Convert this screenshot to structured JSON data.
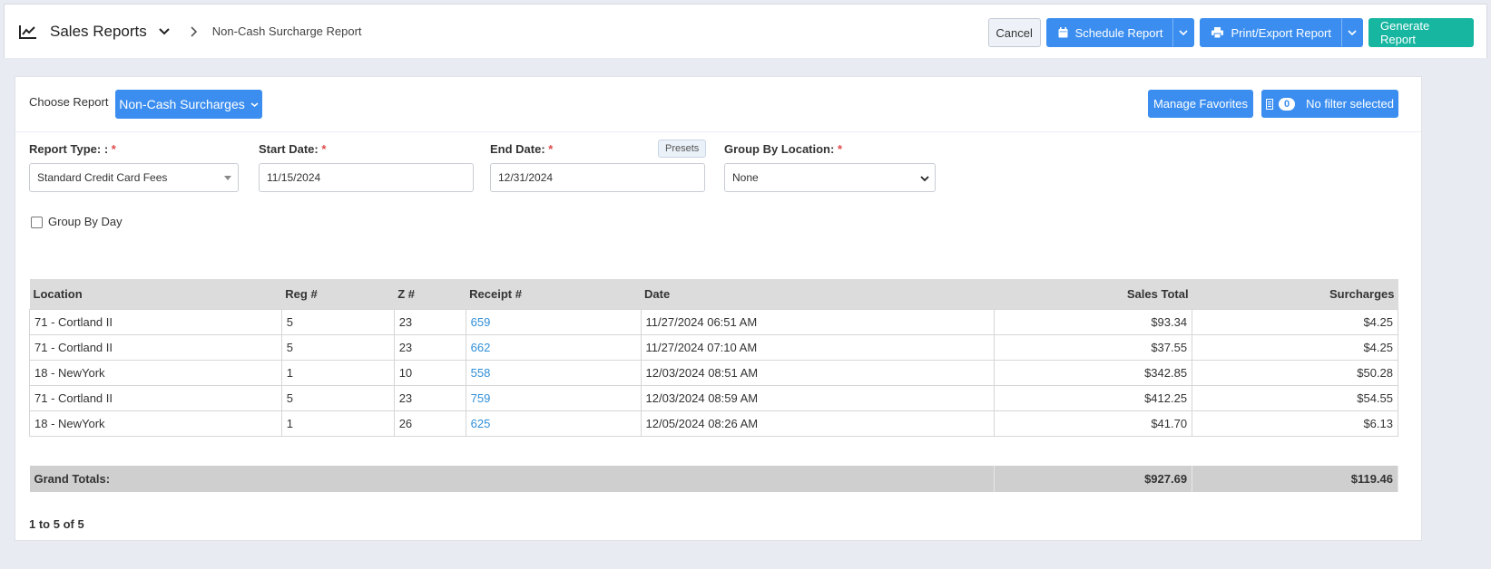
{
  "header": {
    "title": "Sales Reports",
    "breadcrumb": "Non-Cash Surcharge Report",
    "buttons": {
      "cancel": "Cancel",
      "schedule": "Schedule Report",
      "print_export": "Print/Export Report",
      "generate": "Generate Report"
    }
  },
  "toolbar": {
    "choose_label": "Choose Report",
    "choose_value": "Non-Cash Surcharges",
    "manage_favorites": "Manage Favorites",
    "filter_count": "0",
    "filter_label": "No filter selected"
  },
  "form": {
    "report_type": {
      "label": "Report Type: :",
      "value": "Standard Credit Card Fees"
    },
    "start_date": {
      "label": "Start Date:",
      "value": "11/15/2024"
    },
    "end_date": {
      "label": "End Date:",
      "value": "12/31/2024",
      "presets": "Presets"
    },
    "group_by_location": {
      "label": "Group By Location:",
      "value": "None"
    },
    "required_mark": "*",
    "group_by_day": {
      "label": "Group By Day",
      "checked": false
    }
  },
  "table": {
    "columns": [
      "Location",
      "Reg #",
      "Z #",
      "Receipt #",
      "Date",
      "Sales Total",
      "Surcharges"
    ],
    "rows": [
      [
        "71 - Cortland II",
        "5",
        "23",
        "659",
        "11/27/2024 06:51 AM",
        "$93.34",
        "$4.25"
      ],
      [
        "71 - Cortland II",
        "5",
        "23",
        "662",
        "11/27/2024 07:10 AM",
        "$37.55",
        "$4.25"
      ],
      [
        "18 - NewYork",
        "1",
        "10",
        "558",
        "12/03/2024 08:51 AM",
        "$342.85",
        "$50.28"
      ],
      [
        "71 - Cortland II",
        "5",
        "23",
        "759",
        "12/03/2024 08:59 AM",
        "$412.25",
        "$54.55"
      ],
      [
        "18 - NewYork",
        "1",
        "26",
        "625",
        "12/05/2024 08:26 AM",
        "$41.70",
        "$6.13"
      ]
    ],
    "totals": {
      "label": "Grand Totals:",
      "sales_total": "$927.69",
      "surcharges": "$119.46"
    },
    "pager": "1 to 5 of 5"
  }
}
